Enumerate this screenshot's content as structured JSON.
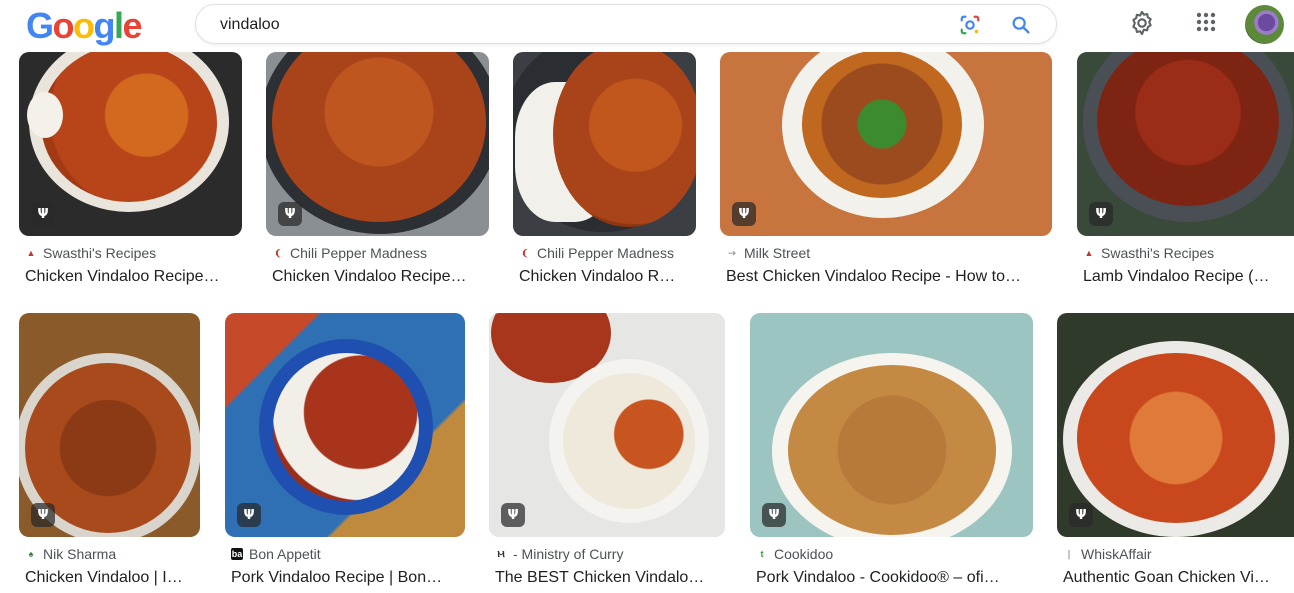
{
  "search": {
    "query": "vindaloo"
  },
  "colors": {
    "logo": [
      "#4285F4",
      "#EA4335",
      "#FBBC05",
      "#4285F4",
      "#34A853",
      "#EA4335"
    ]
  },
  "logo_letters": [
    "G",
    "o",
    "o",
    "g",
    "l",
    "e"
  ],
  "recipe_badge_icon": "fork-knife-icon",
  "rows": [
    [
      {
        "source": "Swasthi's Recipes",
        "title": "Chicken Vindaloo Recipe…",
        "badge": true
      },
      {
        "source": "Chili Pepper Madness",
        "title": "Chicken Vindaloo Recipe…",
        "badge": true
      },
      {
        "source": "Chili Pepper Madness",
        "title": "Chicken Vindaloo R…",
        "badge": false
      },
      {
        "source": "Milk Street",
        "title": "Best Chicken Vindaloo Recipe - How to…",
        "badge": true
      },
      {
        "source": "Swasthi's Recipes",
        "title": "Lamb Vindaloo Recipe (…",
        "badge": true
      }
    ],
    [
      {
        "source": "Nik Sharma",
        "title": "Chicken Vindaloo | I…",
        "badge": true
      },
      {
        "source": "Bon Appetit",
        "title": "Pork Vindaloo Recipe | Bon…",
        "badge": true
      },
      {
        "source": "- Ministry of Curry",
        "title": "The BEST Chicken Vindalo…",
        "badge": true
      },
      {
        "source": "Cookidoo",
        "title": "Pork Vindaloo - Cookidoo® – ofi…",
        "badge": true
      },
      {
        "source": "WhiskAffair",
        "title": "Authentic Goan Chicken Vi…",
        "badge": true
      }
    ]
  ]
}
